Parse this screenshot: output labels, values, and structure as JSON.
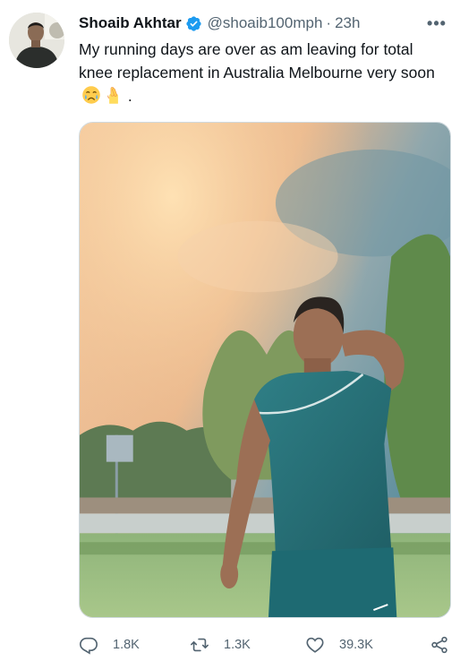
{
  "tweet": {
    "author": {
      "display_name": "Shoaib Akhtar",
      "handle": "@shoaib100mph",
      "verified": true,
      "avatar_icon": "profile-photo"
    },
    "separator": "·",
    "timestamp": "23h",
    "more_icon": "more-options-icon",
    "text": "My running days are over as am leaving for total knee replacement in Australia Melbourne very soon",
    "text_suffix": ".",
    "emojis": [
      "crying-face-emoji",
      "crossed-fingers-emoji"
    ],
    "media": {
      "type": "photo"
    },
    "actions": {
      "reply_count": "1.8K",
      "retweet_count": "1.3K",
      "like_count": "39.3K"
    },
    "colors": {
      "verified": "#1d9bf0",
      "secondary_text": "#536471",
      "primary_text": "#0f1419"
    }
  }
}
